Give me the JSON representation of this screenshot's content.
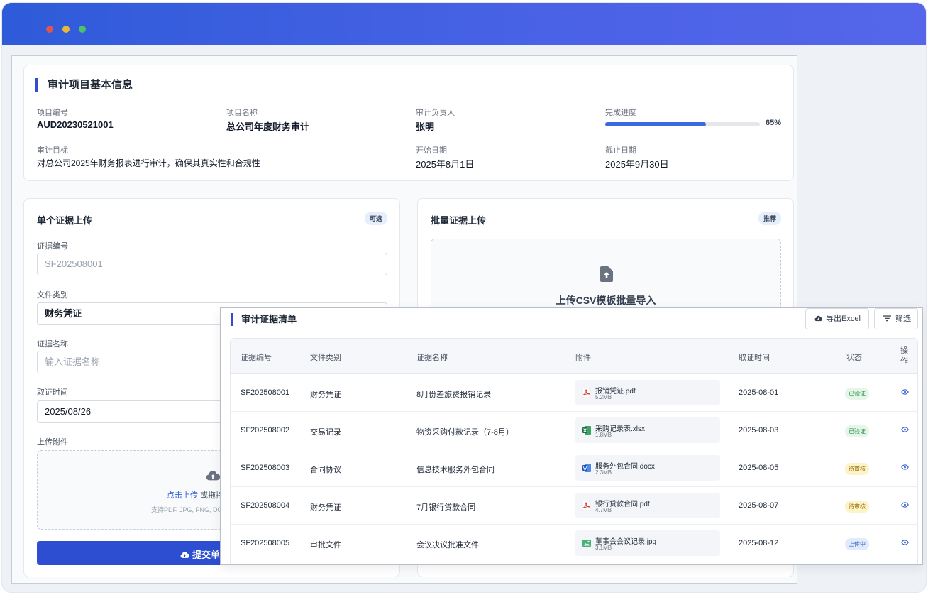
{
  "window": {
    "controls": [
      "close",
      "minimize",
      "maximize"
    ]
  },
  "project_info": {
    "title": "审计项目基本信息",
    "fields": [
      {
        "label": "项目编号",
        "value": "AUD20230521001"
      },
      {
        "label": "项目名称",
        "value": "总公司年度财务审计"
      },
      {
        "label": "审计负责人",
        "value": "张明"
      },
      {
        "label": "完成进度",
        "value": "65%"
      },
      {
        "label": "审计目标",
        "value": "对总公司2025年财务报表进行审计，确保其真实性和合规性"
      },
      {
        "label": "开始日期",
        "value": "2025年8月1日"
      },
      {
        "label": "截止日期",
        "value": "2025年9月30日"
      }
    ],
    "progress": 0.65,
    "accent_color": "#2f4fd0"
  },
  "single_upload": {
    "title": "单个证据上传",
    "tag": "可选",
    "fields": [
      {
        "label": "证据编号",
        "value": "",
        "placeholder": "SF202508001"
      },
      {
        "label": "文件类别",
        "value": "财务凭证",
        "placeholder": ""
      },
      {
        "label": "证据名称",
        "value": "",
        "placeholder": "输入证据名称"
      },
      {
        "label": "取证时间",
        "value": "2025/08/26",
        "placeholder": ""
      },
      {
        "label": "上传附件",
        "value": "",
        "placeholder": ""
      }
    ],
    "dropzone": {
      "link_text": "点击上传",
      "text_partial": " 或拖拽",
      "hint_partial": "支持PDF, JPG, PNG, DO"
    },
    "submit_label": "提交单个"
  },
  "batch_upload": {
    "title": "批量证据上传",
    "tag": "推荐",
    "drop_text": "上传CSV模板批量导入"
  },
  "evidence_list": {
    "title": "审计证据清单",
    "export_label": "导出Excel",
    "filter_label": "筛选",
    "columns": [
      "证据编号",
      "文件类别",
      "证据名称",
      "附件",
      "取证时间",
      "状态",
      "操作"
    ],
    "rows": [
      {
        "id": "SF202508001",
        "category": "财务凭证",
        "name": "8月份差旅费报销记录",
        "file": "报销凭证.pdf",
        "size": "5.2MB",
        "file_type": "pdf",
        "date": "2025-08-01",
        "status": "已验证",
        "status_type": "verified"
      },
      {
        "id": "SF202508002",
        "category": "交易记录",
        "name": "物资采购付款记录（7-8月）",
        "file": "采购记录表.xlsx",
        "size": "1.8MB",
        "file_type": "excel",
        "date": "2025-08-03",
        "status": "已验证",
        "status_type": "verified"
      },
      {
        "id": "SF202508003",
        "category": "合同协议",
        "name": "信息技术服务外包合同",
        "file": "服务外包合同.docx",
        "size": "2.3MB",
        "file_type": "word",
        "date": "2025-08-05",
        "status": "待审核",
        "status_type": "pending"
      },
      {
        "id": "SF202508004",
        "category": "财务凭证",
        "name": "7月银行贷款合同",
        "file": "银行贷款合同.pdf",
        "size": "4.7MB",
        "file_type": "pdf",
        "date": "2025-08-07",
        "status": "待审核",
        "status_type": "pending"
      },
      {
        "id": "SF202508005",
        "category": "审批文件",
        "name": "会议决议批准文件",
        "file": "董事会会议记录.jpg",
        "size": "3.1MB",
        "file_type": "image",
        "date": "2025-08-12",
        "status": "上传中",
        "status_type": "uploading"
      }
    ],
    "status_colors": {
      "verified": {
        "bg": "#e3f6e8",
        "fg": "#2f8a4a"
      },
      "pending": {
        "bg": "#fdf3c9",
        "fg": "#9a6b00"
      },
      "uploading": {
        "bg": "#e2ebfb",
        "fg": "#2f5bc8"
      }
    }
  }
}
